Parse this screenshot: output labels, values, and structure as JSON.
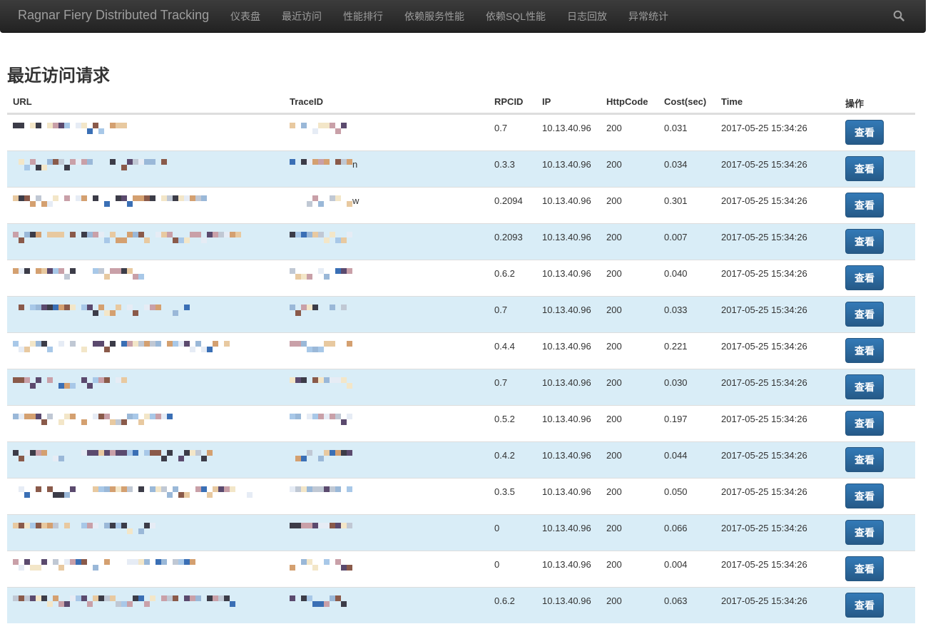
{
  "nav": {
    "brand": "Ragnar Fiery Distributed Tracking",
    "items": [
      "仪表盘",
      "最近访问",
      "性能排行",
      "依赖服务性能",
      "依赖SQL性能",
      "日志回放",
      "异常统计"
    ]
  },
  "page": {
    "title": "最近访问请求"
  },
  "table": {
    "headers": [
      "URL",
      "TraceID",
      "RPCID",
      "IP",
      "HttpCode",
      "Cost(sec)",
      "Time",
      "操作"
    ],
    "action_label": "查看",
    "rows": [
      {
        "trace_suffix": "",
        "rpcid": "0.7",
        "ip": "10.13.40.96",
        "code": "200",
        "cost": "0.031",
        "time": "2017-05-25 15:34:26"
      },
      {
        "trace_suffix": "n",
        "rpcid": "0.3.3",
        "ip": "10.13.40.96",
        "code": "200",
        "cost": "0.034",
        "time": "2017-05-25 15:34:26"
      },
      {
        "trace_suffix": "w",
        "rpcid": "0.2094",
        "ip": "10.13.40.96",
        "code": "200",
        "cost": "0.301",
        "time": "2017-05-25 15:34:26"
      },
      {
        "trace_suffix": "",
        "rpcid": "0.2093",
        "ip": "10.13.40.96",
        "code": "200",
        "cost": "0.007",
        "time": "2017-05-25 15:34:26"
      },
      {
        "trace_suffix": "",
        "rpcid": "0.6.2",
        "ip": "10.13.40.96",
        "code": "200",
        "cost": "0.040",
        "time": "2017-05-25 15:34:26"
      },
      {
        "trace_suffix": "",
        "rpcid": "0.7",
        "ip": "10.13.40.96",
        "code": "200",
        "cost": "0.033",
        "time": "2017-05-25 15:34:26"
      },
      {
        "trace_suffix": "",
        "rpcid": "0.4.4",
        "ip": "10.13.40.96",
        "code": "200",
        "cost": "0.221",
        "time": "2017-05-25 15:34:26"
      },
      {
        "trace_suffix": "",
        "rpcid": "0.7",
        "ip": "10.13.40.96",
        "code": "200",
        "cost": "0.030",
        "time": "2017-05-25 15:34:26"
      },
      {
        "trace_suffix": "",
        "rpcid": "0.5.2",
        "ip": "10.13.40.96",
        "code": "200",
        "cost": "0.197",
        "time": "2017-05-25 15:34:26"
      },
      {
        "trace_suffix": "",
        "rpcid": "0.4.2",
        "ip": "10.13.40.96",
        "code": "200",
        "cost": "0.044",
        "time": "2017-05-25 15:34:26"
      },
      {
        "trace_suffix": "",
        "rpcid": "0.3.5",
        "ip": "10.13.40.96",
        "code": "200",
        "cost": "0.050",
        "time": "2017-05-25 15:34:26"
      },
      {
        "trace_suffix": "",
        "rpcid": "0",
        "ip": "10.13.40.96",
        "code": "200",
        "cost": "0.066",
        "time": "2017-05-25 15:34:26"
      },
      {
        "trace_suffix": "",
        "rpcid": "0",
        "ip": "10.13.40.96",
        "code": "200",
        "cost": "0.004",
        "time": "2017-05-25 15:34:26"
      },
      {
        "trace_suffix": "",
        "rpcid": "0.6.2",
        "ip": "10.13.40.96",
        "code": "200",
        "cost": "0.063",
        "time": "2017-05-25 15:34:26"
      }
    ]
  },
  "icons": {
    "search": "search-icon"
  },
  "colors": {
    "navbar": "#222222",
    "stripe": "#d9edf7",
    "button": "#337ab7",
    "nav_text": "#9d9d9d"
  }
}
